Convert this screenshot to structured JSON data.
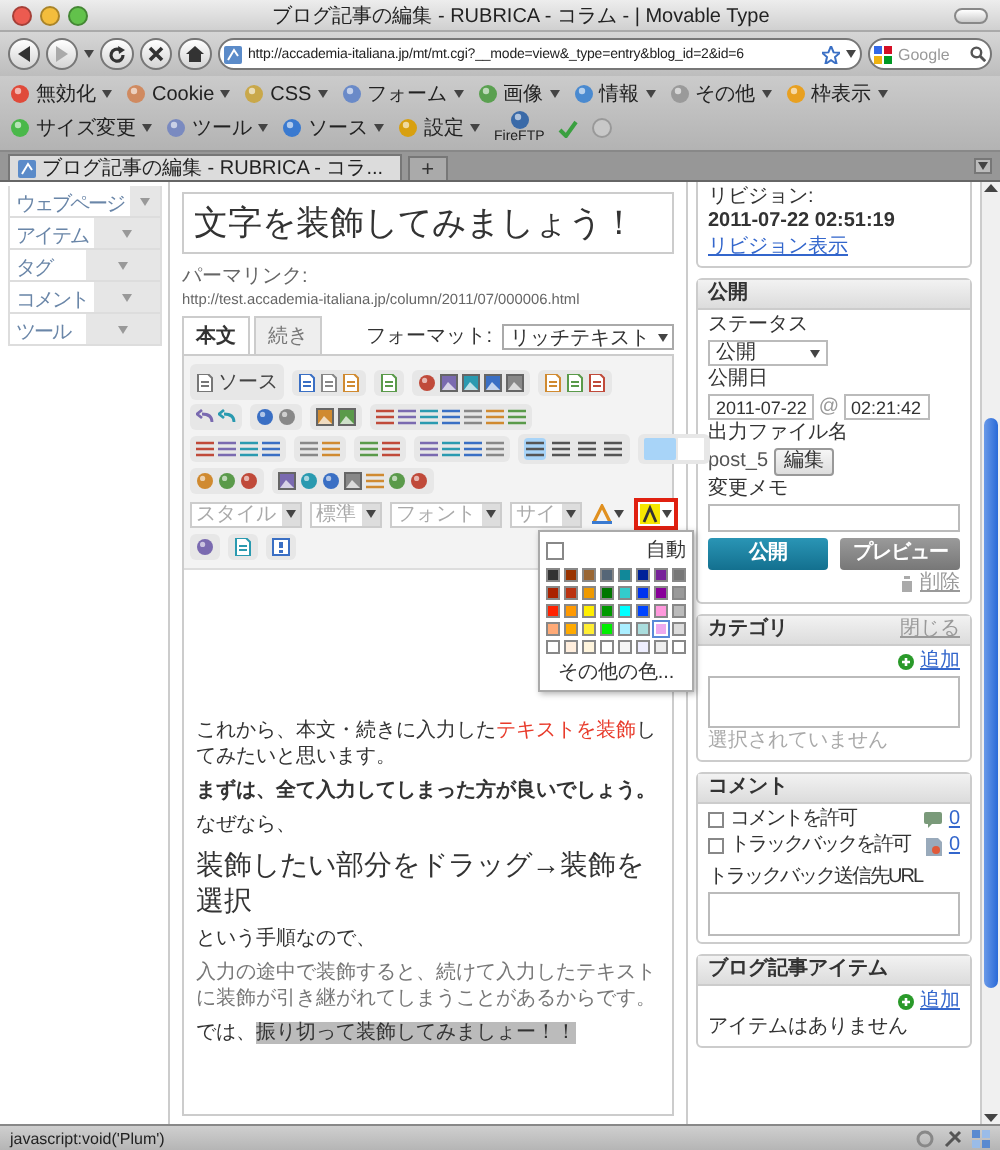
{
  "window": {
    "title": "ブログ記事の編集 - RUBRICA - コラム - | Movable Type"
  },
  "navigation": {
    "url": "http://accademia-italiana.jp/mt/mt.cgi?__mode=view&_type=entry&blog_id=2&id=6",
    "search": {
      "placeholder": "Google"
    }
  },
  "bookmarks": [
    {
      "label": "無効化",
      "kind": "menu"
    },
    {
      "label": "Cookie",
      "kind": "menu"
    },
    {
      "label": "CSS",
      "kind": "menu"
    },
    {
      "label": "フォーム",
      "kind": "menu"
    },
    {
      "label": "画像",
      "kind": "menu"
    },
    {
      "label": "情報",
      "kind": "menu"
    },
    {
      "label": "その他",
      "kind": "menu"
    },
    {
      "label": "枠表示",
      "kind": "menu"
    },
    {
      "label": "サイズ変更",
      "kind": "menu"
    },
    {
      "label": "ツール",
      "kind": "menu"
    },
    {
      "label": "ソース",
      "kind": "menu"
    },
    {
      "label": "設定",
      "kind": "menu"
    },
    {
      "label": "FireFTP",
      "kind": "button"
    }
  ],
  "tabs": [
    {
      "label": "ブログ記事の編集 - RUBRICA - コラ...",
      "selected": true
    }
  ],
  "new_tab": "+",
  "sidebar": {
    "items": [
      {
        "label": "ウェブページ"
      },
      {
        "label": "アイテム"
      },
      {
        "label": "タグ"
      },
      {
        "label": "コメント"
      },
      {
        "label": "ツール"
      }
    ]
  },
  "entry": {
    "title": "文字を装飾してみましょう！",
    "permalink_label": "パーマリンク:",
    "permalink": "http://test.accademia-italiana.jp/column/2011/07/000006.html",
    "editor_tabs": [
      {
        "label": "本文",
        "selected": true
      },
      {
        "label": "続き",
        "selected": false
      }
    ],
    "format_label": "フォーマット:",
    "format": "リッチテキスト",
    "toolbar": {
      "source_label": "ソース",
      "align_buttons": [
        {
          "selected": true
        },
        {
          "selected": false
        },
        {
          "selected": false
        },
        {
          "selected": false
        }
      ],
      "combos": [
        {
          "label": "スタイル",
          "disabled": true
        },
        {
          "label": "標準",
          "disabled": true
        },
        {
          "label": "フォント",
          "disabled": true
        },
        {
          "label": "サイ",
          "disabled": true
        }
      ]
    },
    "color_picker": {
      "auto_label": "自動",
      "more_label": "その他の色...",
      "swatch_rows": [
        [
          {
            "color": "#333333",
            "selected": false
          },
          {
            "color": "#993300",
            "selected": false
          },
          {
            "color": "#996633",
            "selected": false
          },
          {
            "color": "#556677",
            "selected": false
          },
          {
            "color": "#118899",
            "selected": false
          },
          {
            "color": "#002299",
            "selected": false
          },
          {
            "color": "#772299",
            "selected": false
          },
          {
            "color": "#777777",
            "selected": false
          }
        ],
        [
          {
            "color": "#aa2200",
            "selected": false
          },
          {
            "color": "#bb3311",
            "selected": false
          },
          {
            "color": "#ee9900",
            "selected": false
          },
          {
            "color": "#007700",
            "selected": false
          },
          {
            "color": "#33cccc",
            "selected": false
          },
          {
            "color": "#0033ee",
            "selected": false
          },
          {
            "color": "#880099",
            "selected": false
          },
          {
            "color": "#999999",
            "selected": false
          }
        ],
        [
          {
            "color": "#ff2200",
            "selected": false
          },
          {
            "color": "#ff9900",
            "selected": false
          },
          {
            "color": "#ffee00",
            "selected": false
          },
          {
            "color": "#009900",
            "selected": false
          },
          {
            "color": "#00ffff",
            "selected": false
          },
          {
            "color": "#0044ff",
            "selected": false
          },
          {
            "color": "#ff99dd",
            "selected": false
          },
          {
            "color": "#bbbbbb",
            "selected": false
          }
        ],
        [
          {
            "color": "#ffaa77",
            "selected": false
          },
          {
            "color": "#ffaa00",
            "selected": false
          },
          {
            "color": "#ffee33",
            "selected": false
          },
          {
            "color": "#00ee00",
            "selected": false
          },
          {
            "color": "#aaeeff",
            "selected": false
          },
          {
            "color": "#aadddd",
            "selected": false
          },
          {
            "color": "#eeaaee",
            "selected": true
          },
          {
            "color": "#dddddd",
            "selected": false
          }
        ],
        [
          {
            "color": "#ffffff",
            "selected": false
          },
          {
            "color": "#ffeedd",
            "selected": false
          },
          {
            "color": "#fff5dd",
            "selected": false
          },
          {
            "color": "#ffffff",
            "selected": false
          },
          {
            "color": "#f5f5f5",
            "selected": false
          },
          {
            "color": "#eeeeff",
            "selected": false
          },
          {
            "color": "#eeeeee",
            "selected": false
          },
          {
            "color": "#ffffff",
            "selected": false
          }
        ]
      ]
    },
    "body": [
      {
        "kind": "text",
        "parts": [
          {
            "text": "これから、本文・続きに入力した",
            "kind": "plain"
          },
          {
            "text": "テキストを装飾",
            "kind": "emphasis"
          },
          {
            "text": "してみたいと思います。",
            "kind": "plain"
          }
        ]
      },
      {
        "kind": "bold",
        "parts": [
          {
            "text": "まずは、全て入力してしまった方が良いでしょう。",
            "kind": "plain"
          }
        ]
      },
      {
        "kind": "text",
        "parts": [
          {
            "text": "なぜなら、",
            "kind": "plain"
          }
        ]
      },
      {
        "kind": "heading",
        "parts": [
          {
            "text": "装飾したい部分をドラッグ→装飾を選択",
            "kind": "plain"
          }
        ]
      },
      {
        "kind": "text",
        "parts": [
          {
            "text": "という手順なので、",
            "kind": "plain"
          }
        ]
      },
      {
        "kind": "muted",
        "parts": [
          {
            "text": "入力の途中で装飾すると、続けて入力したテキストに装飾が引き継がれてしまうことがあるからです。",
            "kind": "plain"
          }
        ]
      },
      {
        "kind": "text",
        "parts": [
          {
            "text": "では、",
            "kind": "plain"
          },
          {
            "text": "振り切って装飾してみましょー！！",
            "kind": "marked"
          }
        ]
      }
    ]
  },
  "revision": {
    "label": "リビジョン:",
    "date": "2011-07-22 02:51:19",
    "link": "リビジョン表示"
  },
  "publish": {
    "header": "公開",
    "status_label": "ステータス",
    "status": "公開",
    "date_label": "公開日",
    "date": "2011-07-22",
    "at": "@",
    "time": "02:21:42",
    "file_label": "出力ファイル名",
    "file": "post_5",
    "edit_button": "編集",
    "memo_label": "変更メモ",
    "buttons": [
      {
        "label": "公開",
        "kind": "primary"
      },
      {
        "label": "プレビュー",
        "kind": "secondary"
      }
    ],
    "delete": "削除"
  },
  "category": {
    "header": "カテゴリ",
    "close": "閉じる",
    "add": "追加",
    "empty": "選択されていません"
  },
  "comments": {
    "header": "コメント",
    "options": [
      {
        "label": "コメントを許可",
        "checked": false,
        "count": "0",
        "kind": "comment"
      },
      {
        "label": "トラックバックを許可",
        "checked": false,
        "count": "0",
        "kind": "trackback"
      }
    ],
    "url_label": "トラックバック送信先URL"
  },
  "entry_items": {
    "header": "ブログ記事アイテム",
    "add": "追加",
    "empty": "アイテムはありません"
  },
  "status_bar": "javascript:void('Plum')"
}
